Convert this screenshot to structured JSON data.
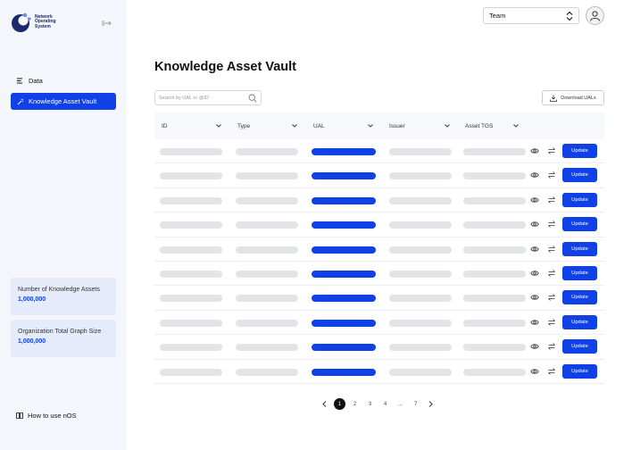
{
  "sidebar": {
    "logo_lines": [
      "Network",
      "Operating",
      "System"
    ],
    "nav": [
      {
        "label": "Data",
        "icon": "list-icon",
        "active": false
      },
      {
        "label": "Knowledge Asset Vault",
        "icon": "wand-icon",
        "active": true
      }
    ],
    "stats": [
      {
        "label": "Number of Knowledge Assets",
        "value": "1,000,000"
      },
      {
        "label": "Organization Total Graph Size",
        "value": "1,000,000"
      }
    ],
    "help_label": "How to use nOS"
  },
  "header": {
    "team_select_value": "Team"
  },
  "main": {
    "title": "Knowledge Asset Vault",
    "search_placeholder": "Search by UAL or @ID",
    "download_label": "Download UALs",
    "columns": [
      "ID",
      "Type",
      "UAL",
      "Issuer",
      "Asset TGS"
    ],
    "update_label": "Update",
    "row_count": 10,
    "pagination": [
      "1",
      "2",
      "3",
      "4",
      "...",
      "7"
    ],
    "current_page": "1"
  },
  "colors": {
    "accent": "#0f41e6",
    "sidebar_bg": "#f4f6fc",
    "stat_bg": "#e6ebfb",
    "placeholder_pill": "#e3e4e8"
  }
}
